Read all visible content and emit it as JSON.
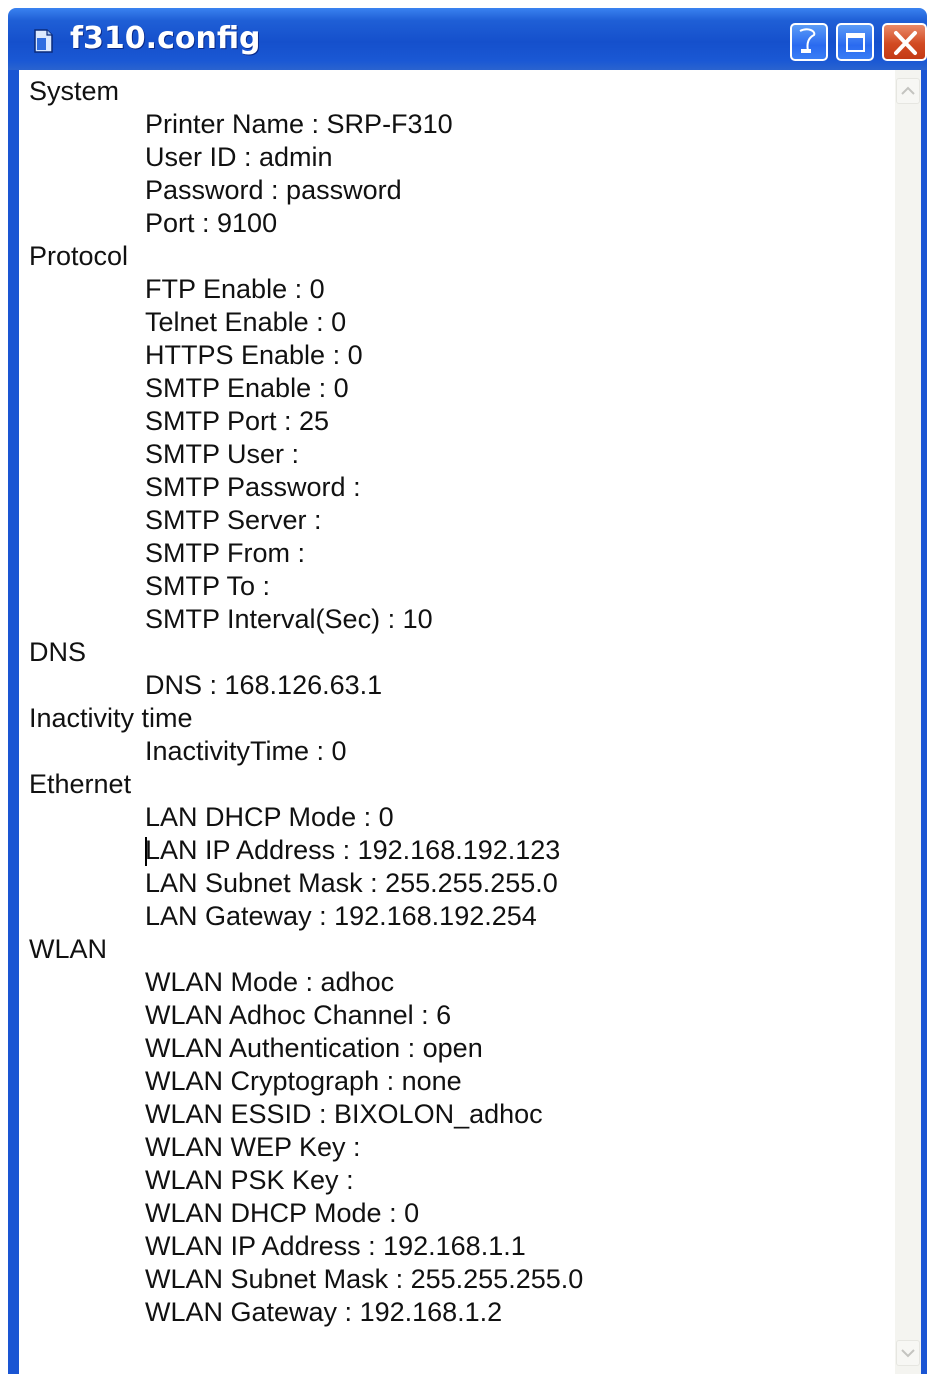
{
  "window": {
    "title": "f310.config",
    "title_bar_color": "#1550cc",
    "icons": {
      "app": "document-icon",
      "minimize": "minimize-icon",
      "maximize": "maximize-icon",
      "close": "close-icon"
    }
  },
  "config": [
    {
      "section": "System",
      "items": [
        "Printer Name : SRP-F310",
        "User ID : admin",
        "Password : password",
        "Port : 9100"
      ]
    },
    {
      "section": "Protocol",
      "items": [
        "FTP Enable : 0",
        "Telnet Enable : 0",
        "HTTPS Enable : 0",
        "SMTP Enable : 0",
        "SMTP Port : 25",
        "SMTP User :",
        "SMTP Password :",
        "SMTP Server :",
        "SMTP From :",
        "SMTP To :",
        "SMTP Interval(Sec) : 10"
      ]
    },
    {
      "section": "DNS",
      "items": [
        "DNS : 168.126.63.1"
      ]
    },
    {
      "section": "Inactivity time",
      "items": [
        "InactivityTime : 0"
      ]
    },
    {
      "section": "Ethernet",
      "items": [
        "LAN DHCP Mode : 0",
        "LAN IP Address : 192.168.192.123",
        "LAN Subnet Mask : 255.255.255.0",
        "LAN Gateway : 192.168.192.254"
      ]
    },
    {
      "section": "WLAN",
      "items": [
        "WLAN Mode : adhoc",
        "WLAN Adhoc Channel : 6",
        "WLAN Authentication : open",
        "WLAN Cryptograph : none",
        "WLAN ESSID : BIXOLON_adhoc",
        "WLAN WEP Key :",
        "WLAN PSK Key :",
        "WLAN DHCP Mode : 0",
        "WLAN IP Address : 192.168.1.1",
        "WLAN Subnet Mask : 255.255.255.0",
        "WLAN Gateway : 192.168.1.2"
      ]
    }
  ],
  "scrollbar": {
    "up_icon": "scroll-up-arrow-icon",
    "down_icon": "scroll-down-arrow-icon"
  }
}
